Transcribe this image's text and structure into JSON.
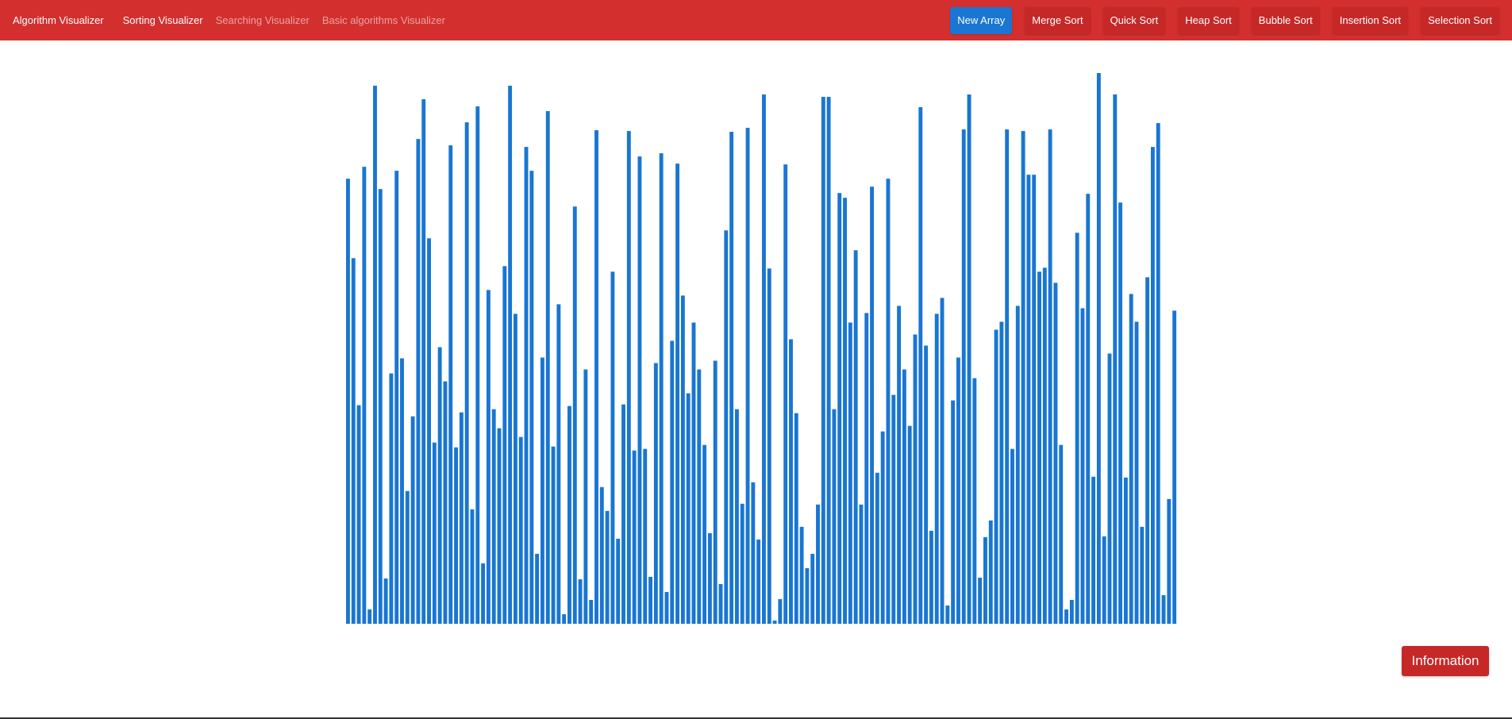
{
  "colors": {
    "navbar": "#d32f2f",
    "button_primary": "#1976d2",
    "button_danger": "#c62828",
    "bar": "#1976d2"
  },
  "navbar": {
    "brand": "Algorithm Visualizer",
    "links": {
      "sorting": "Sorting Visualizer",
      "searching": "Searching Visualizer",
      "basic": "Basic algorithms Visualizer"
    },
    "buttons": {
      "new_array": "New Array",
      "merge_sort": "Merge Sort",
      "quick_sort": "Quick Sort",
      "heap_sort": "Heap Sort",
      "bubble_sort": "Bubble Sort",
      "insertion_sort": "Insertion Sort",
      "selection_sort": "Selection Sort"
    }
  },
  "information_button": "Information",
  "array": {
    "max_value": 690,
    "values": [
      560,
      460,
      275,
      575,
      18,
      677,
      547,
      57,
      315,
      570,
      334,
      167,
      261,
      610,
      660,
      485,
      228,
      348,
      305,
      602,
      222,
      266,
      631,
      144,
      651,
      76,
      420,
      270,
      246,
      450,
      677,
      390,
      235,
      600,
      570,
      88,
      335,
      645,
      223,
      402,
      12,
      274,
      525,
      56,
      320,
      30,
      621,
      172,
      142,
      443,
      107,
      276,
      620,
      218,
      588,
      220,
      59,
      328,
      592,
      40,
      356,
      579,
      413,
      290,
      379,
      320,
      225,
      114,
      331,
      50,
      495,
      619,
      270,
      151,
      624,
      178,
      106,
      666,
      447,
      4,
      31,
      578,
      358,
      265,
      122,
      70,
      88,
      150,
      663,
      663,
      270,
      542,
      536,
      379,
      470,
      150,
      391,
      550,
      190,
      242,
      560,
      288,
      400,
      320,
      249,
      364,
      650,
      350,
      117,
      390,
      410,
      23,
      281,
      335,
      622,
      666,
      309,
      58,
      109,
      130,
      370,
      380,
      622,
      220,
      400,
      620,
      565,
      565,
      443,
      448,
      622,
      429,
      225,
      18,
      30,
      492,
      397,
      541,
      185,
      693,
      110,
      340,
      666,
      530,
      184,
      415,
      380,
      122,
      436,
      600,
      630,
      36,
      157,
      394
    ]
  }
}
